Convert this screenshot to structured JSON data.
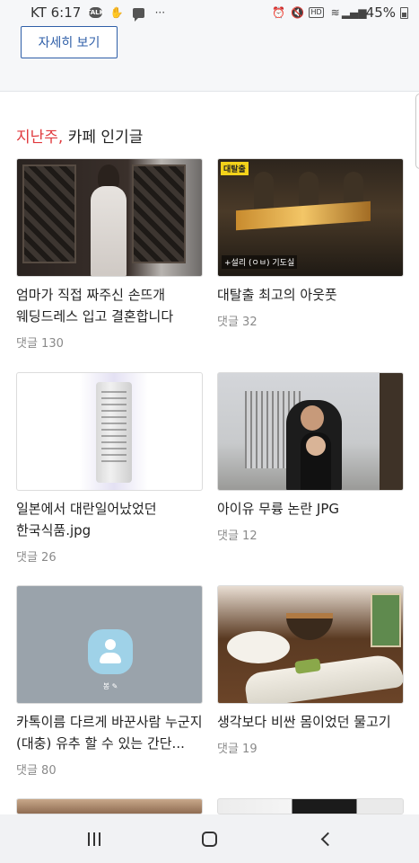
{
  "status_bar": {
    "carrier_time": "KT 6:17",
    "battery": "45%",
    "icons": [
      "talk-icon",
      "hand-icon",
      "chat-icon",
      "more-icon",
      "alarm-icon",
      "mute-icon",
      "hd-icon",
      "wifi-icon",
      "signal-icon",
      "battery-icon"
    ],
    "more_glyph": "···",
    "hd_label": "HD"
  },
  "top": {
    "detail_button_label": "자세히 보기"
  },
  "section": {
    "title_accent": "지난주,",
    "title_rest": " 카페 인기글"
  },
  "cards": [
    {
      "title": "엄마가 직접 짜주신 손뜨개 웨딩드레스 입고 결혼합니다^^(+후...",
      "comments": "댓글 130"
    },
    {
      "title": "대탈출 최고의 아웃풋",
      "comments": "댓글 32",
      "thumb_tag": "대탈출",
      "thumb_caption": "+설리 (ㅇㅂ) 기도실"
    },
    {
      "title": "일본에서 대란일어났었던 한국식품.jpg",
      "comments": "댓글 26"
    },
    {
      "title": "아이유 무륭 논란 JPG",
      "comments": "댓글 12"
    },
    {
      "title": "카톡이름 다르게 바꾼사람 누군지(대충) 유추 할 수 있는 간단...",
      "comments": "댓글 80",
      "thumb_name": "봉 ✎"
    },
    {
      "title": "생각보다 비싼 몸이었던 물고기",
      "comments": "댓글 19"
    }
  ],
  "colors": {
    "accent_red": "#e03a3e",
    "button_blue": "#2f5fa8",
    "comment_gray": "#8a8a8a"
  },
  "nav": {
    "items": [
      "recent-apps-icon",
      "home-icon",
      "back-icon"
    ]
  }
}
